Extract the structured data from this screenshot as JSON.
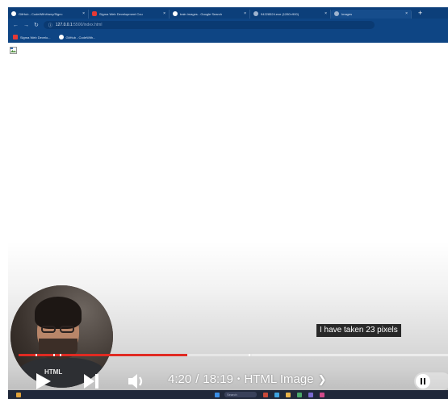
{
  "browser": {
    "tabs": [
      {
        "title": "GitHub - CodeWithHarry/Sigm:",
        "favicon": "github-icon",
        "color": "#ffffff",
        "active": false
      },
      {
        "title": "Sigma Web Development Cou",
        "favicon": "youtube-icon",
        "color": "#e53935",
        "active": false
      },
      {
        "title": "train images - Google Search",
        "favicon": "google-icon",
        "color": "#ffffff",
        "active": false
      },
      {
        "title": "94228524.exe (1280×900)",
        "favicon": "globe-icon",
        "color": "#9fb4cf",
        "active": false
      },
      {
        "title": "Images",
        "favicon": "globe-icon",
        "color": "#9fb4cf",
        "active": true
      }
    ],
    "tab_close_glyph": "×",
    "new_tab_glyph": "+",
    "url_host": "127.0.0.1",
    "url_path": ":5500/index.html",
    "bookmarks": [
      {
        "label": "Sigma Web Develo...",
        "color": "#e53935"
      },
      {
        "label": "GitHub - CodeWith...",
        "color": "#ffffff"
      }
    ]
  },
  "video": {
    "caption": "I have taken 23 pixels",
    "current_time": "4:20",
    "duration": "18:19",
    "time_separator": "/",
    "chapter_bullet": "•",
    "chapter_title": "HTML Image",
    "chapter_arrow": "❯",
    "progress_played_fraction": 0.392,
    "progress_buffered_fraction": 0.544,
    "chapter_marks_fraction": [
      0.04,
      0.08,
      0.095,
      0.535
    ],
    "played_color": "#e02a22",
    "presenter_shirt_text": "HTML"
  },
  "taskbar": {
    "search_label": "Search"
  }
}
